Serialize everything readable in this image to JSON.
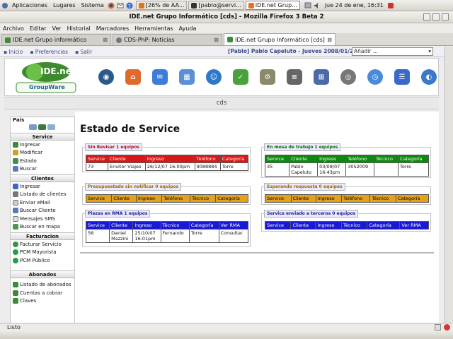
{
  "gnome_panel": {
    "menus": [
      "Aplicaciones",
      "Lugares",
      "Sistema"
    ],
    "tasks": [
      "[26% de AA...",
      "[pablo@servi...",
      "IDE.net Grup..."
    ],
    "clock": "jue 24 de ene, 16:31"
  },
  "window": {
    "title": "IDE.net Grupo Informático [cds] - Mozilla Firefox 3 Beta 2"
  },
  "menubar": [
    "Archivo",
    "Editar",
    "Ver",
    "Historial",
    "Marcadores",
    "Herramientas",
    "Ayuda"
  ],
  "tabs": [
    {
      "label": "IDE.net Grupo informático"
    },
    {
      "label": "CDS-PhP: Noticias"
    },
    {
      "label": "IDE.net Grupo Informático [cds]"
    }
  ],
  "appbar": {
    "links": [
      "Inicio",
      "Preferencias",
      "Salir"
    ],
    "user": "[Pablo] Pablo Capeluto - Jueves 2008/01/24",
    "select_value": "Añadir ..."
  },
  "logo": {
    "name": "IDE.net",
    "sub": "GroupWare"
  },
  "header": {
    "title": "cds"
  },
  "sidebar": {
    "top_label": "País",
    "sections": [
      {
        "title": "Service",
        "items": [
          "Ingresar",
          "Modificar",
          "Estado",
          "Buscar"
        ]
      },
      {
        "title": "Clientes",
        "items": [
          "Ingresar",
          "Listado de clientes",
          "Enviar eMail",
          "Buscar Cliente",
          "Mensajes SMS",
          "Buscar en mapa"
        ]
      },
      {
        "title": "Facturacion",
        "items": [
          "Facturar Servicio",
          "PCM Mayorista",
          "PCM Público"
        ]
      },
      {
        "title": "Abonados",
        "items": [
          "Listado de abonados",
          "Cuentas a cobrar",
          "Claves"
        ]
      }
    ]
  },
  "main": {
    "page_title": "Estado de Service",
    "panels": {
      "sin_revisar": {
        "title": "Sin Revisar 1 equipos",
        "columns": [
          "Service",
          "Cliente",
          "Ingreso",
          "Teléfono",
          "Categoría"
        ],
        "rows": [
          [
            "73",
            "Envitor Viajes",
            "26/12/07 16:00pm",
            "9088884",
            "Torre"
          ]
        ]
      },
      "en_mesa": {
        "title": "En mesa de trabajo 1 equipos",
        "columns": [
          "Service",
          "Cliente",
          "Ingreso",
          "Teléfono",
          "Técnico",
          "Categoría"
        ],
        "rows": [
          [
            "35",
            "Pablo\nCapeluto",
            "03/09/07\n16:43pm",
            "3052009",
            "",
            "Torre"
          ]
        ]
      },
      "presupuestado": {
        "title": "Presupuestado sin notificar 0 equipos",
        "columns": [
          "Service",
          "Cliente",
          "Ingreso",
          "Teléfono",
          "Técnico",
          "Categoría"
        ],
        "rows": []
      },
      "esperando": {
        "title": "Esperando respuesta 0 equipos",
        "columns": [
          "Service",
          "Cliente",
          "Ingreso",
          "Teléfono",
          "Técnico",
          "Categoría"
        ],
        "rows": []
      },
      "rma": {
        "title": "Piezas en RMA 1 equipos",
        "columns": [
          "Service",
          "Cliente",
          "Ingreso",
          "Técnico",
          "Categoría",
          "Ver RMA"
        ],
        "rows": [
          [
            "58",
            "Daniel\nMazzini",
            "25/10/07\n16:01pm",
            "Fernando",
            "Torre",
            "Consultar"
          ]
        ]
      },
      "terceros": {
        "title": "Service enviado a terceros 0 equipos",
        "columns": [
          "Service",
          "Cliente",
          "Ingreso",
          "Técnico",
          "Categoría",
          "Ver RMA"
        ],
        "rows": []
      }
    }
  },
  "status": {
    "text": "Listo"
  },
  "colors": {
    "red": "#d81818",
    "green": "#0c8a0c",
    "orange": "#e3a21a",
    "blue": "#1a1ad6"
  }
}
